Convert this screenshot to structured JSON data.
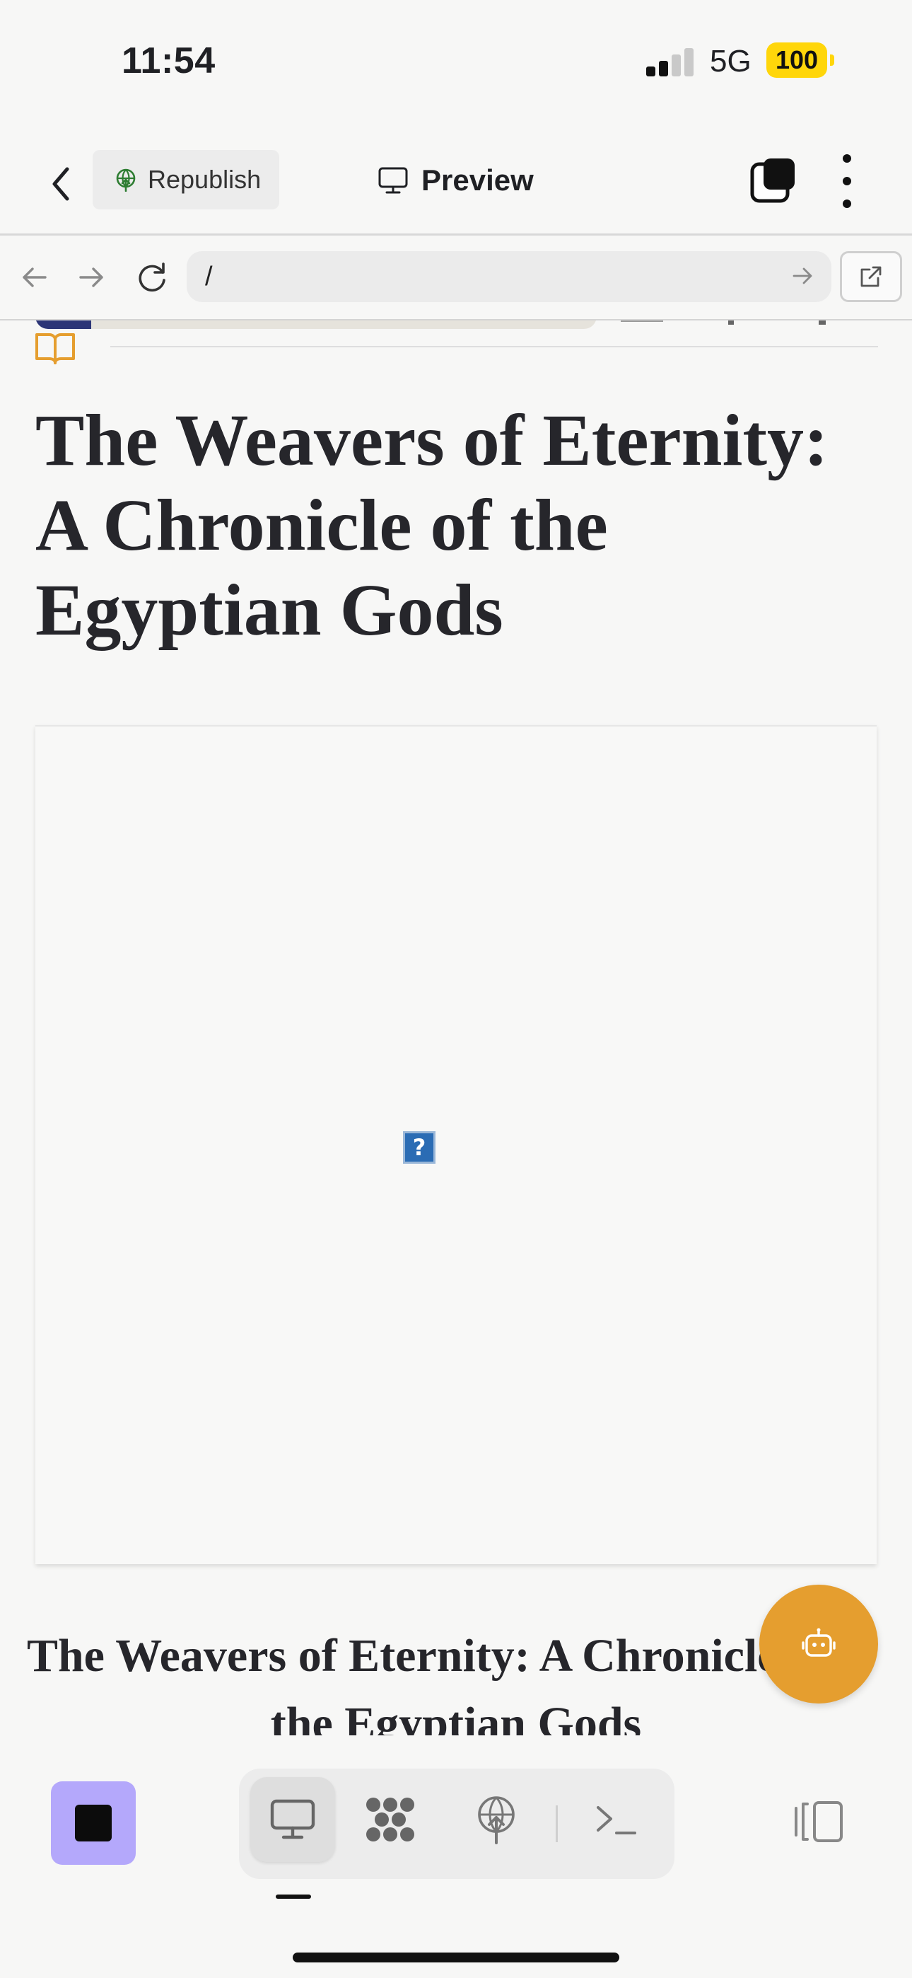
{
  "status_bar": {
    "time": "11:54",
    "network": "5G",
    "battery": "100"
  },
  "topbar": {
    "republish_label": "Republish",
    "preview_label": "Preview"
  },
  "urlbar": {
    "url": "/"
  },
  "document": {
    "title": "The Weavers of Eternity: A Chronicle of the Egyptian Gods",
    "reading_progress": 0.1,
    "broken_image_glyph": "?",
    "caption_line1": "The Weavers of Eternity: A Chronicle of",
    "caption_line2": "the Egyptian Gods"
  },
  "colors": {
    "accent_orange": "#e59e2f",
    "stop_button": "#b4a8fb",
    "progress_fill": "#2c3577",
    "battery": "#ffd60a"
  },
  "icons": {
    "back": "chevron-left-icon",
    "republish": "globe-upload-icon",
    "preview": "monitor-icon",
    "tabs": "tabs-icon",
    "more": "more-vertical-icon",
    "assistant": "robot-icon",
    "dev_mode": "monitor-icon",
    "workflow": "nodes-icon",
    "deploy": "globe-upload-icon",
    "shell": "terminal-icon",
    "panel": "panel-toggle-icon"
  }
}
